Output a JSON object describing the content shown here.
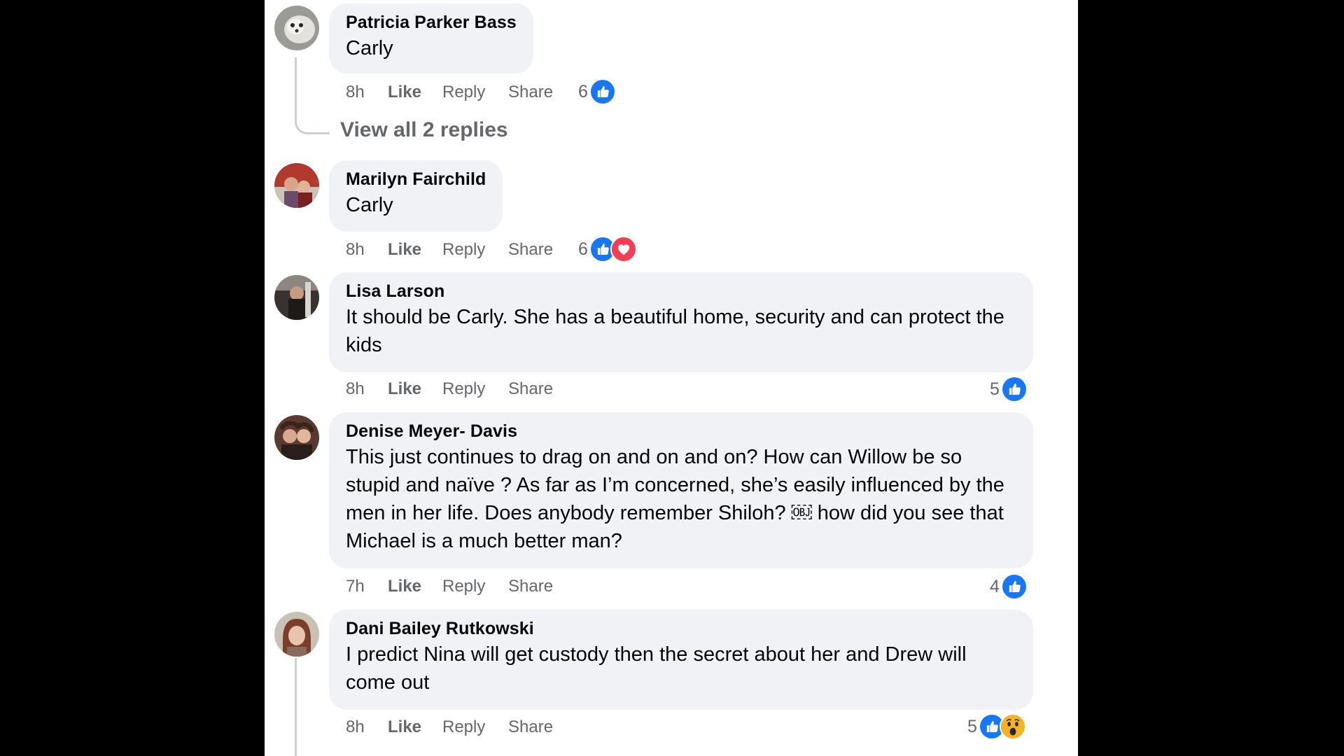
{
  "comments": [
    {
      "name": "Patricia Parker Bass",
      "text": "Carly",
      "time": "8h",
      "like_label": "Like",
      "reply_label": "Reply",
      "share_label": "Share",
      "reaction_count": "6",
      "reactions": [
        "like-icon"
      ]
    },
    {
      "name": "Marilyn Fairchild",
      "text": "Carly",
      "time": "8h",
      "like_label": "Like",
      "reply_label": "Reply",
      "share_label": "Share",
      "reaction_count": "6",
      "reactions": [
        "like-icon",
        "love-icon"
      ]
    },
    {
      "name": "Lisa Larson",
      "text": "It should be Carly. She has a beautiful home, security and can protect the kids",
      "time": "8h",
      "like_label": "Like",
      "reply_label": "Reply",
      "share_label": "Share",
      "reaction_count": "5",
      "reactions": [
        "like-icon"
      ]
    },
    {
      "name": "Denise Meyer- Davis",
      "text": "This just continues to drag on and on and on? How can Willow be so stupid and naïve ? As far as I’m concerned, she’s easily influenced by the men in her life. Does anybody remember Shiloh? ￼ how did you see that Michael is a much better man?",
      "time": "7h",
      "like_label": "Like",
      "reply_label": "Reply",
      "share_label": "Share",
      "reaction_count": "4",
      "reactions": [
        "like-icon"
      ]
    },
    {
      "name": "Dani Bailey Rutkowski",
      "text": "I predict Nina will get custody then the secret about her and Drew will come out",
      "time": "8h",
      "like_label": "Like",
      "reply_label": "Reply",
      "share_label": "Share",
      "reaction_count": "5",
      "reactions": [
        "like-icon",
        "wow-icon"
      ]
    }
  ],
  "view_replies_label": "View all 2 replies",
  "colors": {
    "bubble": "#f0f2f5",
    "like_blue": "#1877f2",
    "love_red": "#f33e58",
    "wow_yellow": "#f7b125",
    "meta_gray": "#65676b"
  }
}
